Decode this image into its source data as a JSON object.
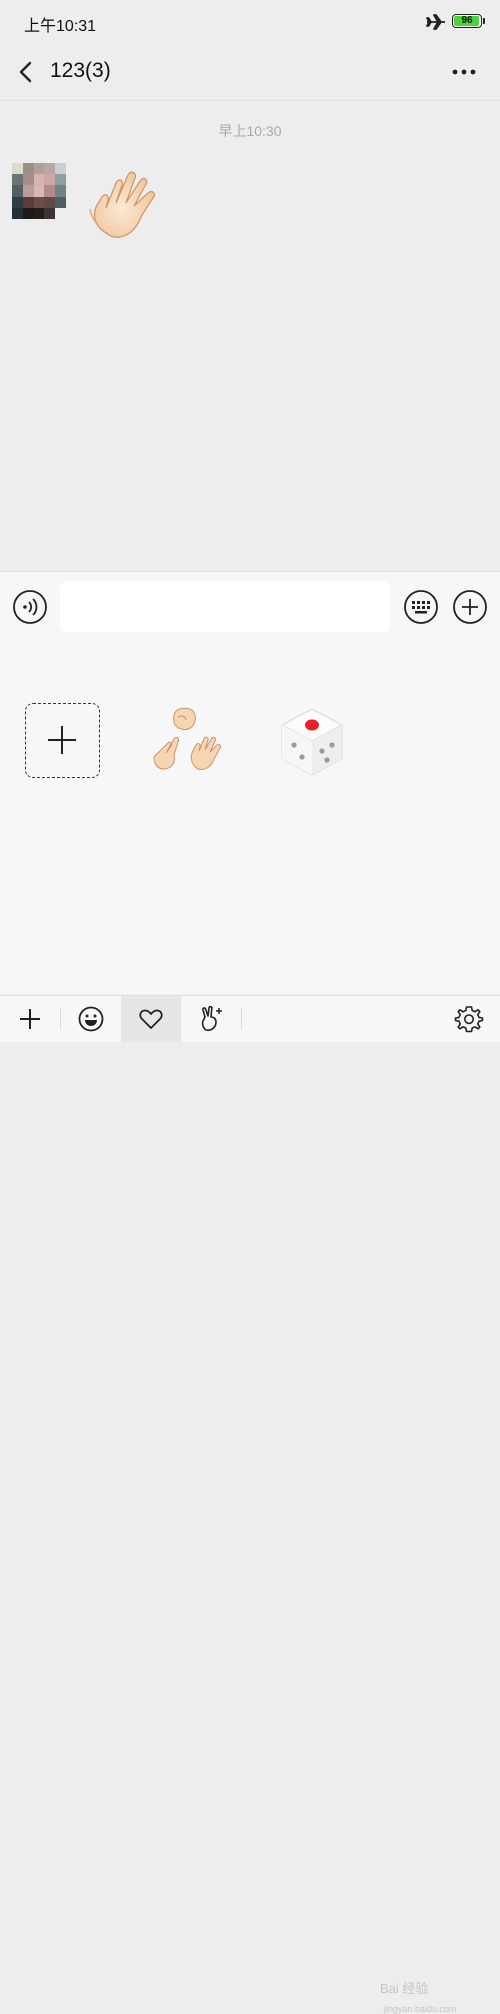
{
  "status_bar": {
    "time": "上午10:31",
    "battery": "96",
    "battery_level": 0.96,
    "airplane_icon": "airplane-icon"
  },
  "nav": {
    "title": "123(3)",
    "back_icon": "chevron-left-icon",
    "more_icon": "more-dots-icon"
  },
  "chat": {
    "timestamp": "早上10:30",
    "messages": [
      {
        "type": "sticker",
        "sticker": "waving-hand"
      }
    ]
  },
  "input_bar": {
    "voice_icon": "voice-icon",
    "text_value": "",
    "keyboard_icon": "keyboard-icon",
    "plus_icon": "plus-circle-icon"
  },
  "sticker_panel": {
    "items": [
      "add-sticker",
      "rock-paper-scissors",
      "dice"
    ]
  },
  "tabs": [
    {
      "icon": "plus-icon"
    },
    {
      "icon": "smiley-icon"
    },
    {
      "icon": "heart-icon",
      "active": true
    },
    {
      "icon": "victory-hand-icon"
    }
  ],
  "settings_icon": "gear-icon",
  "watermark": {
    "text": "Bai 经验",
    "sub": "jingyan.baidu.com"
  },
  "colors": {
    "background": "#ededed",
    "panel": "#f7f7f7",
    "battery_green": "#49d33c",
    "dice_pip": "#e8202a"
  }
}
